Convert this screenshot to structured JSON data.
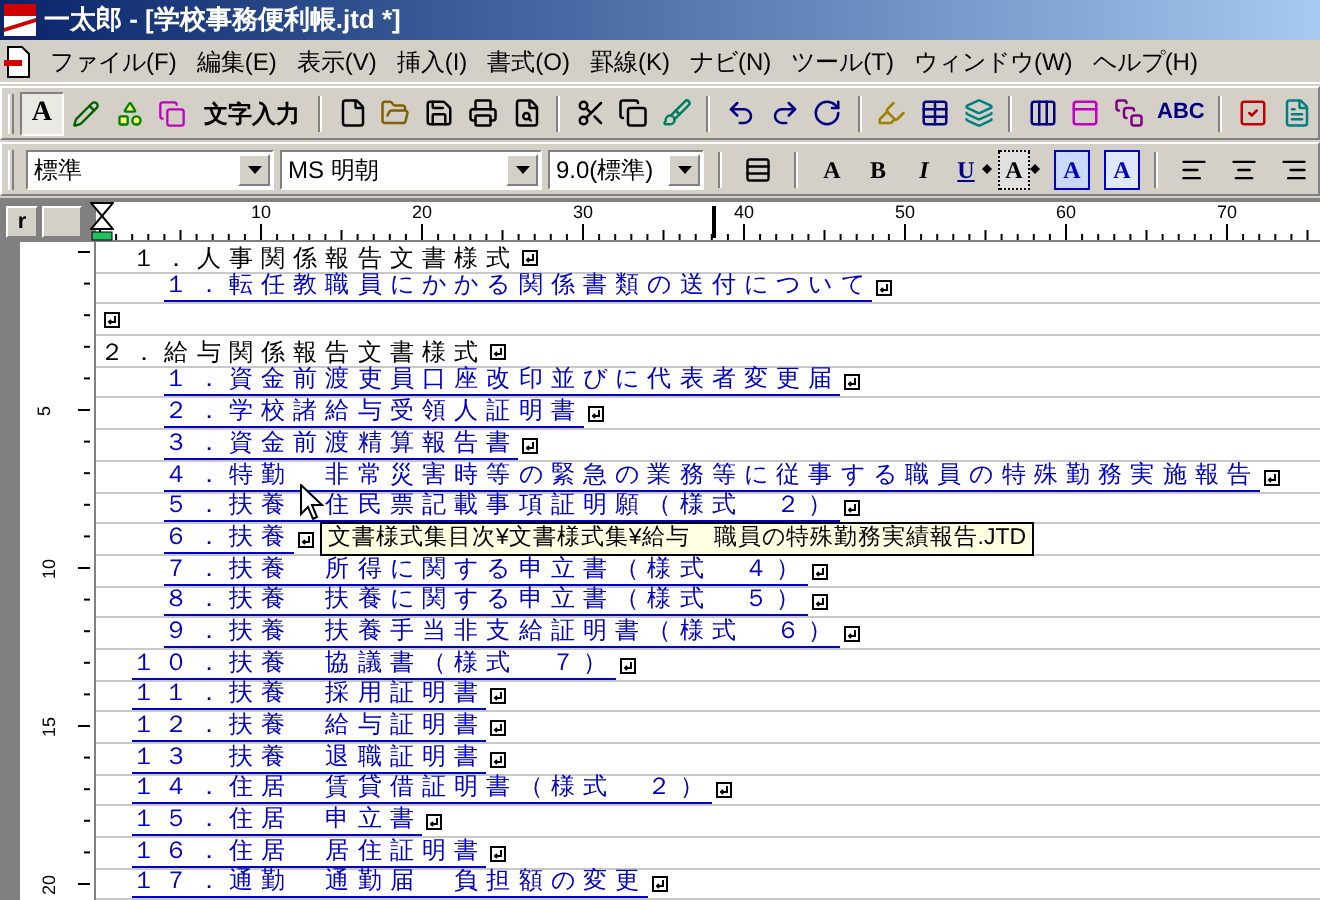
{
  "window": {
    "title": "一太郎 - [学校事務便利帳.jtd *]"
  },
  "menu": [
    "ファイル(F)",
    "編集(E)",
    "表示(V)",
    "挿入(I)",
    "書式(O)",
    "罫線(K)",
    "ナビ(N)",
    "ツール(T)",
    "ウィンドウ(W)",
    "ヘルプ(H)"
  ],
  "toolbar": {
    "modes": [
      {
        "kind": "text",
        "label": "A",
        "selected": true
      },
      {
        "kind": "pen",
        "selected": false
      },
      {
        "kind": "shape",
        "selected": false
      },
      {
        "kind": "frame",
        "selected": false
      }
    ],
    "mode_label": "文字入力",
    "spell_label": "ABC"
  },
  "format_bar": {
    "style": "標準",
    "font": "MS 明朝",
    "size": "9.0(標準)",
    "buttons": [
      {
        "kind": "clear",
        "label": "A"
      },
      {
        "kind": "bold",
        "label": "B"
      },
      {
        "kind": "italic",
        "label": "I"
      },
      {
        "kind": "underline",
        "label": "U"
      },
      {
        "kind": "char_style",
        "label": "A"
      },
      {
        "kind": "boxed",
        "label": "A"
      },
      {
        "kind": "shadow",
        "label": "A"
      }
    ]
  },
  "ruler": {
    "corner": "r",
    "horizontal": [
      "10",
      "20",
      "30",
      "40",
      "50",
      "60",
      "70"
    ],
    "vertical": [
      "5",
      "10",
      "15",
      "20"
    ]
  },
  "document": {
    "paragraphs": [
      {
        "kind": "heading",
        "text": "　１．人事関係報告文書様式"
      },
      {
        "kind": "link",
        "text": "　　１．転任教職員にかかる関係書類の送付について"
      },
      {
        "kind": "blank"
      },
      {
        "kind": "heading",
        "text": "２．給与関係報告文書様式"
      },
      {
        "kind": "link",
        "text": "　　１．資金前渡吏員口座改印並びに代表者変更届"
      },
      {
        "kind": "link",
        "text": "　　２．学校諸給与受領人証明書"
      },
      {
        "kind": "link",
        "text": "　　３．資金前渡精算報告書"
      },
      {
        "kind": "link",
        "text": "　　４．特勤　非常災害時等の緊急の業務等に従事する職員の特殊勤務実施報告"
      },
      {
        "kind": "link",
        "text": "　　５．扶養　住民票記載事項証明願（様式　２）"
      },
      {
        "kind": "link",
        "text": "　　６．扶養"
      },
      {
        "kind": "link",
        "text": "　　７．扶養　所得に関する申立書（様式　４）"
      },
      {
        "kind": "link",
        "text": "　　８．扶養　扶養に関する申立書（様式　５）"
      },
      {
        "kind": "link",
        "text": "　　９．扶養　扶養手当非支給証明書（様式　６）"
      },
      {
        "kind": "link",
        "text": "　１０．扶養　協議書（様式　７）"
      },
      {
        "kind": "link",
        "text": "　１１．扶養　採用証明書"
      },
      {
        "kind": "link",
        "text": "　１２．扶養　給与証明書"
      },
      {
        "kind": "link",
        "text": "　１３　扶養　退職証明書"
      },
      {
        "kind": "link",
        "text": "　１４．住居　賃貸借証明書（様式　２）"
      },
      {
        "kind": "link",
        "text": "　１５．住居　申立書"
      },
      {
        "kind": "link",
        "text": "　１６．住居　居住証明書"
      },
      {
        "kind": "link",
        "text": "　１７．通勤　通勤届　負担額の変更"
      }
    ],
    "tooltip": "文書様式集目次¥文書様式集¥給与　職員の特殊勤務実績報告.JTD"
  }
}
